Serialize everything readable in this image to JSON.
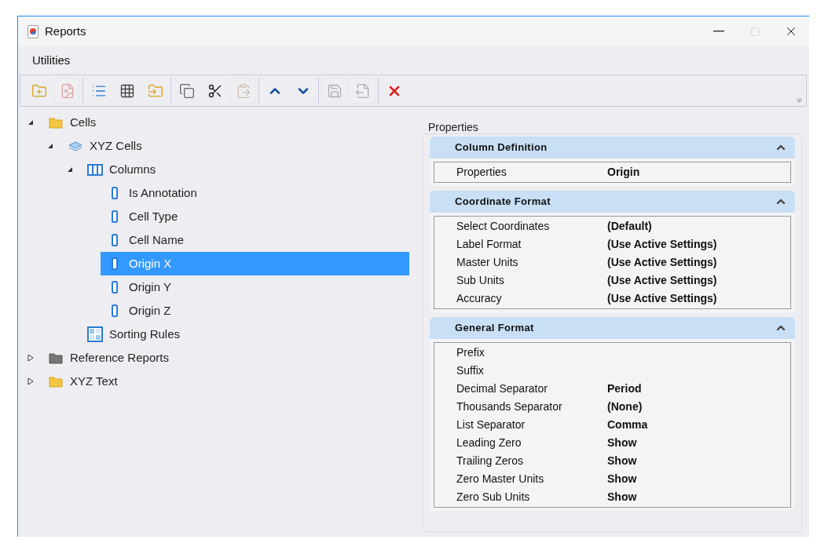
{
  "window": {
    "title": "Reports"
  },
  "menu": [
    {
      "label": "Utilities"
    }
  ],
  "toolbar": [
    [
      {
        "kind": "add-folder",
        "disabled": false
      },
      {
        "kind": "new-report",
        "disabled": true
      }
    ],
    [
      {
        "kind": "list",
        "disabled": false
      },
      {
        "kind": "grid",
        "disabled": false
      },
      {
        "kind": "move",
        "disabled": false
      }
    ],
    [
      {
        "kind": "copy",
        "disabled": false
      },
      {
        "kind": "cut",
        "disabled": false
      },
      {
        "kind": "paste",
        "disabled": true
      }
    ],
    [
      {
        "kind": "up",
        "disabled": false
      },
      {
        "kind": "down",
        "disabled": false
      }
    ],
    [
      {
        "kind": "save",
        "disabled": true
      },
      {
        "kind": "replace",
        "disabled": true
      }
    ],
    [
      {
        "kind": "delete",
        "disabled": false
      }
    ]
  ],
  "tree": [
    {
      "label": "Cells",
      "kind": "folder",
      "expanded": true,
      "selected": false,
      "children": [
        {
          "label": "XYZ Cells",
          "kind": "cells",
          "expanded": true,
          "selected": false,
          "children": [
            {
              "label": "Columns",
              "kind": "columns",
              "expanded": true,
              "selected": false,
              "children": [
                {
                  "label": "Is Annotation",
                  "kind": "column",
                  "selected": false
                },
                {
                  "label": "Cell Type",
                  "kind": "column",
                  "selected": false
                },
                {
                  "label": "Cell Name",
                  "kind": "column",
                  "selected": false
                },
                {
                  "label": "Origin X",
                  "kind": "column",
                  "selected": true
                },
                {
                  "label": "Origin Y",
                  "kind": "column",
                  "selected": false
                },
                {
                  "label": "Origin Z",
                  "kind": "column",
                  "selected": false
                }
              ]
            },
            {
              "label": "Sorting Rules",
              "kind": "sorting",
              "selected": false
            }
          ]
        }
      ]
    },
    {
      "label": "Reference Reports",
      "kind": "folder-dark",
      "expanded": false,
      "selected": false
    },
    {
      "label": "XYZ Text",
      "kind": "folder",
      "expanded": false,
      "selected": false
    }
  ],
  "properties": {
    "title": "Properties",
    "sections": [
      {
        "title": "Column Definition",
        "expanded": true,
        "rows": [
          {
            "label": "Properties",
            "value": "Origin"
          }
        ]
      },
      {
        "title": "Coordinate Format",
        "expanded": true,
        "rows": [
          {
            "label": "Select Coordinates",
            "value": "(Default)"
          },
          {
            "label": "Label Format",
            "value": "(Use Active Settings)"
          },
          {
            "label": "Master Units",
            "value": "(Use Active Settings)"
          },
          {
            "label": "Sub Units",
            "value": "(Use Active Settings)"
          },
          {
            "label": "Accuracy",
            "value": "(Use Active Settings)"
          }
        ]
      },
      {
        "title": "General Format",
        "expanded": true,
        "rows": [
          {
            "label": "Prefix"
          },
          {
            "label": "Suffix"
          },
          {
            "label": "Decimal Separator",
            "value": "Period"
          },
          {
            "label": "Thousands Separator",
            "value": "(None)"
          },
          {
            "label": "List Separator",
            "value": "Comma"
          },
          {
            "label": "Leading Zero",
            "value": "Show"
          },
          {
            "label": "Trailing Zeros",
            "value": "Show"
          },
          {
            "label": "Zero Master Units",
            "value": "Show"
          },
          {
            "label": "Zero Sub Units",
            "value": "Show"
          }
        ]
      }
    ]
  }
}
